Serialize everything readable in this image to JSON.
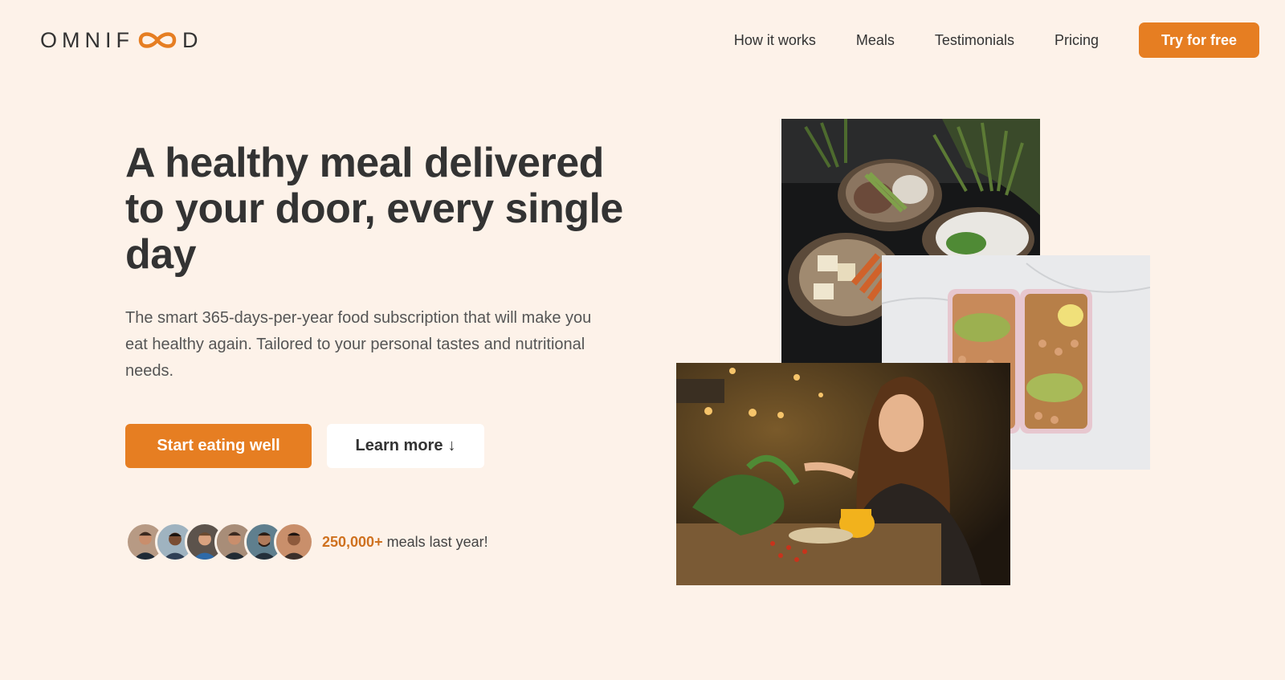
{
  "header": {
    "logo_text_before": "OMNIF",
    "logo_text_after": "D",
    "nav": [
      "How it works",
      "Meals",
      "Testimonials",
      "Pricing"
    ],
    "cta_label": "Try for free"
  },
  "hero": {
    "title": "A healthy meal delivered to your door, every single day",
    "description": "The smart 365-days-per-year food subscription that will make you eat healthy again. Tailored to your personal tastes and nutritional needs.",
    "primary_button": "Start eating well",
    "secondary_button": "Learn more",
    "secondary_button_arrow": "↓",
    "delivered_number": "250,000+",
    "delivered_text": "meals last year!",
    "avatar_count": 6
  },
  "colors": {
    "background": "#fdf2e9",
    "accent": "#e67e22",
    "text": "#333333"
  },
  "icons": [
    "infinity-logo-icon",
    "arrow-down-icon"
  ]
}
